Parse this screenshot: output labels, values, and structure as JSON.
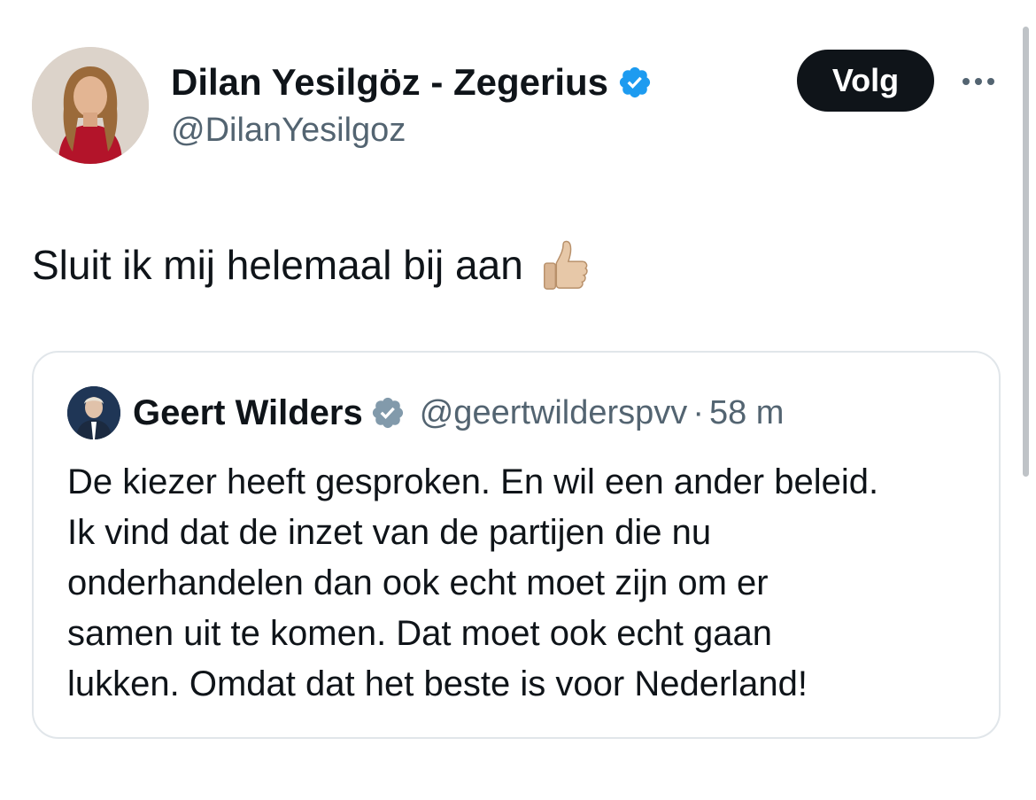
{
  "author": {
    "display_name": "Dilan Yesilgöz - Zegerius",
    "handle": "@DilanYesilgoz",
    "verified_badge_icon": "verified-checkmark-icon",
    "verified_badge_color": "#1d9bf0"
  },
  "actions": {
    "follow_label": "Volg",
    "more_icon": "more-horizontal-icon"
  },
  "tweet": {
    "text": "Sluit ik mij helemaal bij aan",
    "emoji_icon": "thumbs-up-icon"
  },
  "quoted_tweet": {
    "author_name": "Geert Wilders",
    "handle": "@geertwilderspvv",
    "separator": "·",
    "time": "58 m",
    "verified_badge_icon": "verified-checkmark-icon",
    "verified_badge_color": "#829aab",
    "body_lines": [
      "De kiezer heeft gesproken. En wil een ander beleid.",
      "Ik vind dat de inzet van de partijen die nu",
      "onderhandelen dan ook echt moet zijn om er",
      "samen uit te komen. Dat moet ook echt gaan",
      "lukken. Omdat dat het beste is voor Nederland!"
    ]
  },
  "colors": {
    "text_primary": "#0f1419",
    "text_secondary": "#536471",
    "button_bg": "#0f1419",
    "card_border": "#e1e6ea"
  }
}
